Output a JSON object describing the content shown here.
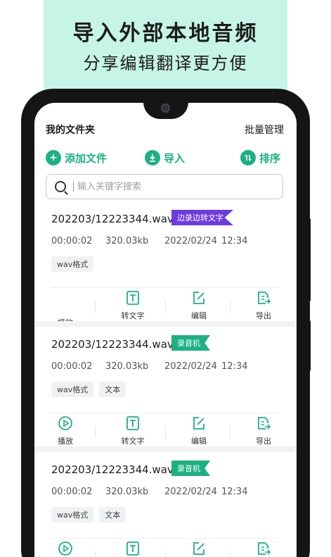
{
  "promo": {
    "headline": "导入外部本地音频",
    "subline": "分享编辑翻译更方便"
  },
  "header": {
    "title": "我的文件夹",
    "batch": "批量管理"
  },
  "actions": {
    "add": "添加文件",
    "import": "导入",
    "sort": "排序"
  },
  "search": {
    "placeholder": "输入关键字搜索"
  },
  "colors": {
    "accent": "#1cb182",
    "tag_purple": "#6e3be0",
    "promo_bg": "#c6f4e6"
  },
  "files": [
    {
      "name": "202203/12223344.wav",
      "tag": "边录边转文字",
      "duration": "00:00:02",
      "size": "320.03kb",
      "date": "2022/02/24",
      "time": "12:34",
      "chips": [
        "wav格式"
      ]
    },
    {
      "name": "202203/12223344.wav",
      "tag": "录音机",
      "duration": "00:00:02",
      "size": "320.03kb",
      "date": "2022/02/24",
      "time": "12:34",
      "chips": [
        "wav格式",
        "文本"
      ]
    },
    {
      "name": "202203/12223344.wav",
      "tag": "录音机",
      "duration": "00:00:02",
      "size": "320.03kb",
      "date": "2022/02/24",
      "time": "12:34",
      "chips": [
        "wav格式",
        "文本"
      ]
    }
  ],
  "ops": {
    "play": "播放",
    "transcribe": "转文字",
    "edit": "编辑",
    "export": "导出"
  }
}
